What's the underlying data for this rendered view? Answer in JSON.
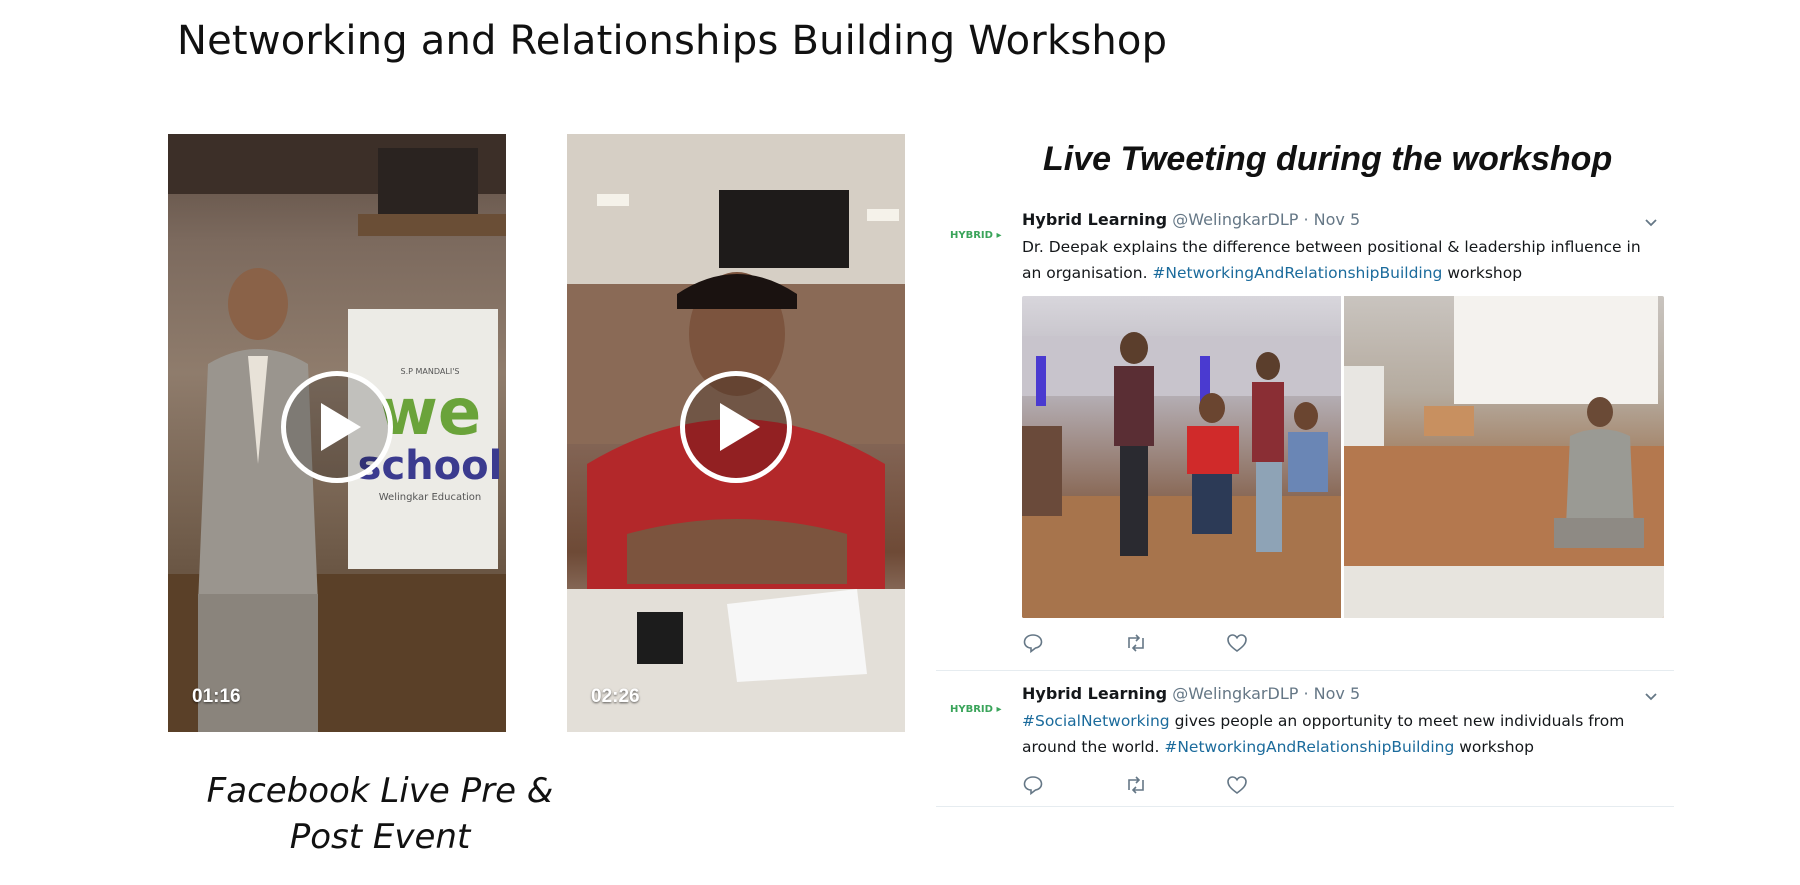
{
  "title": "Networking and Relationships Building Workshop",
  "videos": [
    {
      "duration": "01:16",
      "icon": "play-icon"
    },
    {
      "duration": "02:26",
      "icon": "play-icon"
    }
  ],
  "video1_banner": {
    "line1": "S.P MANDALI'S",
    "line2": "we",
    "line3": "school",
    "line4": "Welingkar Education"
  },
  "facebook_caption": {
    "line1": "Facebook Live Pre &",
    "line2": "Post Event"
  },
  "tweets_heading": "Live Tweeting during the workshop",
  "tweets": [
    {
      "avatar": "HYBRID",
      "author": "Hybrid Learning",
      "handle": "@WelingkarDLP",
      "date": "· Nov 5",
      "text_before": "Dr. Deepak explains the difference between positional & leadership influence in an organisation. ",
      "hashtag1": "#NetworkingAndRelationshipBuilding",
      "text_after": " workshop"
    },
    {
      "avatar": "HYBRID",
      "author": "Hybrid Learning",
      "handle": "@WelingkarDLP",
      "date": "· Nov 5",
      "hashtag0": "#SocialNetworking",
      "text_middle": " gives people an opportunity to meet new individuals from around the world. ",
      "hashtag1": "#NetworkingAndRelationshipBuilding",
      "text_after": " workshop"
    }
  ],
  "colors": {
    "hashtag": "#1b6b9c",
    "meta": "#657786",
    "accent_green": "#3aa45a"
  }
}
